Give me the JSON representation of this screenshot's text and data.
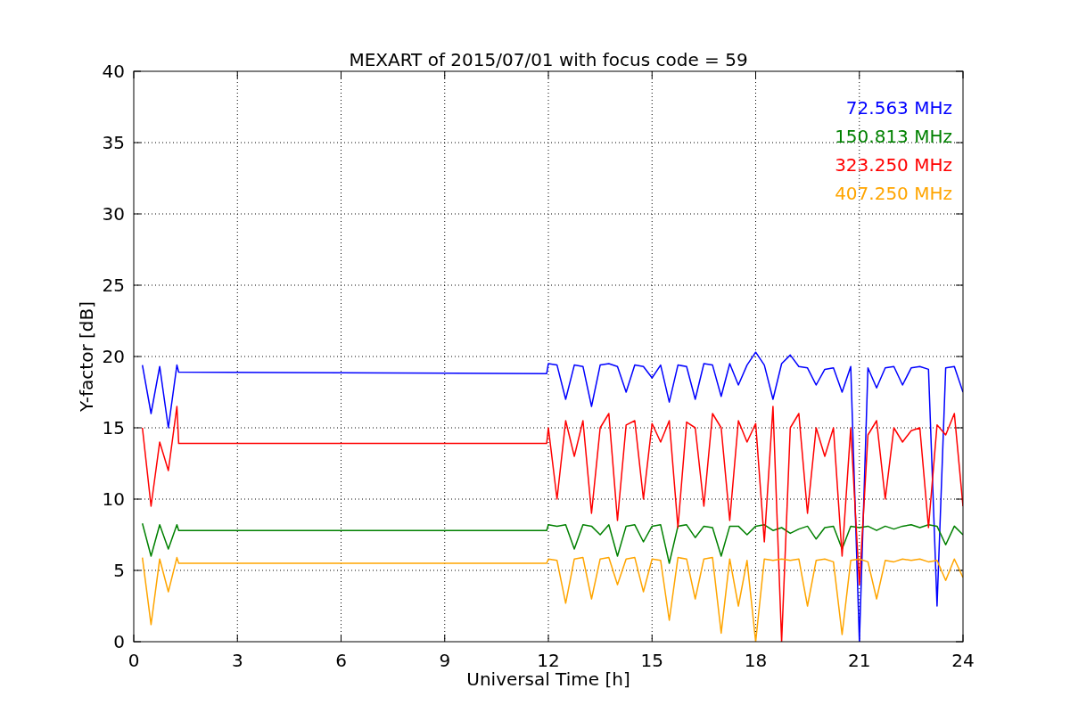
{
  "figure": {
    "chart_data": {
      "type": "line",
      "title": "MEXART of 2015/07/01 with focus code = 59",
      "xlabel": "Universal Time [h]",
      "ylabel": "Y-factor [dB]",
      "xlim": [
        0,
        24
      ],
      "ylim": [
        0,
        40
      ],
      "grid": true,
      "xticks": [
        0,
        3,
        6,
        9,
        12,
        15,
        18,
        21,
        24
      ],
      "yticks": [
        0,
        5,
        10,
        15,
        20,
        25,
        30,
        35,
        40
      ],
      "x": [
        0.25,
        0.5,
        0.75,
        1,
        1.25,
        1.3,
        11.95,
        12,
        12.25,
        12.5,
        12.75,
        13,
        13.25,
        13.5,
        13.75,
        14,
        14.25,
        14.5,
        14.75,
        15,
        15.25,
        15.5,
        15.75,
        16,
        16.25,
        16.5,
        16.75,
        17,
        17.25,
        17.5,
        17.75,
        18,
        18.25,
        18.5,
        18.75,
        19,
        19.25,
        19.5,
        19.75,
        20,
        20.25,
        20.5,
        20.75,
        21,
        21.25,
        21.5,
        21.75,
        22,
        22.25,
        22.5,
        22.75,
        23,
        23.25,
        23.5,
        23.75,
        24
      ],
      "series": [
        {
          "name": "72.563 MHz",
          "color": "#0000ff",
          "values": [
            19.4,
            16,
            19.3,
            15,
            19.4,
            18.9,
            18.8,
            19.5,
            19.4,
            17,
            19.4,
            19.3,
            16.5,
            19.4,
            19.5,
            19.3,
            17.5,
            19.4,
            19.3,
            18.5,
            19.4,
            16.8,
            19.4,
            19.3,
            17,
            19.5,
            19.4,
            17.2,
            19.5,
            18,
            19.4,
            20.3,
            19.4,
            17,
            19.5,
            20.1,
            19.3,
            19.2,
            18,
            19.1,
            19.2,
            17.5,
            19.3,
            0,
            19.2,
            17.8,
            19.2,
            19.3,
            18,
            19.2,
            19.3,
            19.1,
            2.5,
            19.2,
            19.3,
            17.5
          ]
        },
        {
          "name": "150.813 MHz",
          "color": "#008000",
          "values": [
            8.3,
            6,
            8.2,
            6.5,
            8.2,
            7.8,
            7.8,
            8.2,
            8.1,
            8.2,
            6.5,
            8.2,
            8.1,
            7.5,
            8.2,
            6,
            8.1,
            8.2,
            7,
            8.1,
            8.2,
            5.5,
            8.1,
            8.2,
            7.3,
            8.1,
            8.0,
            6,
            8.1,
            8.1,
            7.5,
            8.1,
            8.2,
            7.8,
            8.0,
            7.6,
            7.9,
            8.1,
            7.2,
            8.0,
            8.1,
            6.5,
            8.1,
            8.0,
            8.1,
            7.8,
            8.1,
            7.9,
            8.1,
            8.2,
            8.0,
            8.2,
            8.1,
            6.8,
            8.1,
            7.5
          ]
        },
        {
          "name": "323.250 MHz",
          "color": "#ff0000",
          "values": [
            15,
            9.5,
            14,
            12,
            16.5,
            13.9,
            13.9,
            15,
            10,
            15.5,
            13,
            15.5,
            9,
            15,
            16,
            8.5,
            15.2,
            15.5,
            10,
            15.3,
            14,
            15.5,
            8,
            15.4,
            15,
            9.5,
            16,
            15,
            8.5,
            15.5,
            14,
            15.3,
            7,
            16.5,
            0,
            15,
            16,
            9,
            15,
            13,
            15,
            6,
            15,
            4,
            14.5,
            15.5,
            10,
            15,
            14,
            14.8,
            15,
            8,
            15.2,
            14.5,
            16,
            9.5
          ]
        },
        {
          "name": "407.250 MHz",
          "color": "#ffa500",
          "values": [
            5.9,
            1.2,
            5.8,
            3.5,
            5.9,
            5.5,
            5.5,
            5.8,
            5.7,
            2.7,
            5.8,
            5.9,
            3,
            5.8,
            5.9,
            4,
            5.8,
            5.9,
            3.5,
            5.8,
            5.7,
            1.5,
            5.9,
            5.8,
            3,
            5.8,
            5.9,
            0.6,
            5.8,
            2.5,
            5.7,
            0,
            5.8,
            5.7,
            5.8,
            5.7,
            5.8,
            2.5,
            5.7,
            5.8,
            5.6,
            0.5,
            5.7,
            5.8,
            5.6,
            3,
            5.7,
            5.6,
            5.8,
            5.7,
            5.8,
            5.6,
            5.7,
            4.3,
            5.8,
            4.5
          ]
        }
      ]
    }
  }
}
